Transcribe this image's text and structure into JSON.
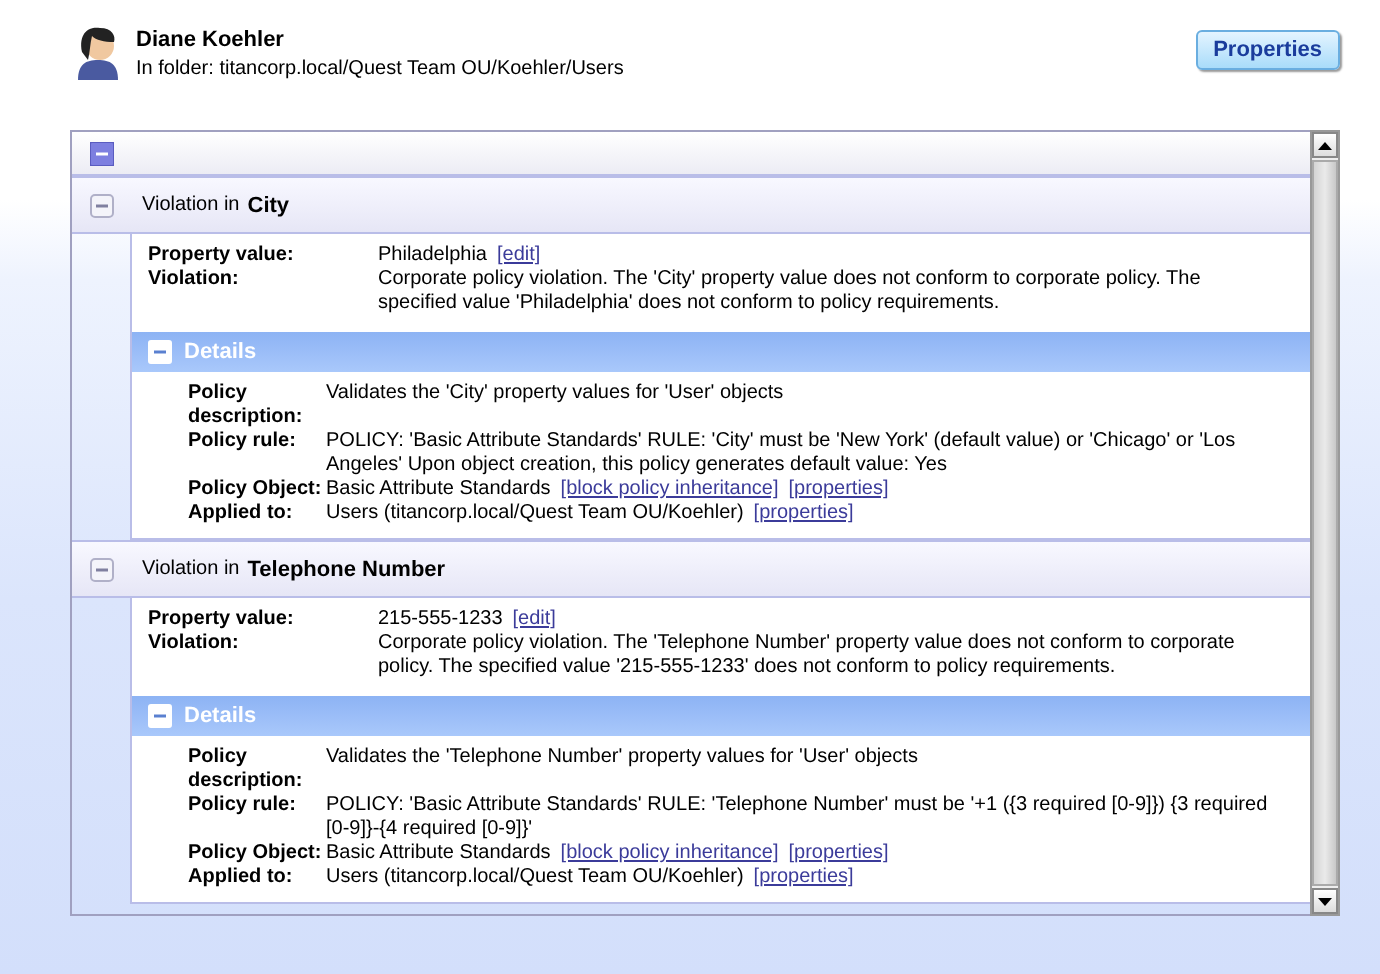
{
  "user": {
    "name": "Diane Koehler",
    "folder": "In folder: titancorp.local/Quest Team OU/Koehler/Users"
  },
  "properties_button": "Properties",
  "all_expanded": true,
  "violations": [
    {
      "label": "Violation in",
      "property": "City",
      "expanded": true,
      "fields": [
        {
          "label": "Property value:",
          "value": "Philadelphia",
          "links": [
            "[edit]"
          ]
        },
        {
          "label": "Violation:",
          "value": "Corporate policy violation. The 'City' property value does not conform to corporate policy. The specified value 'Philadelphia' does not conform to policy requirements."
        }
      ],
      "details": {
        "title": "Details",
        "expanded": true,
        "fields": [
          {
            "label": "Policy description:",
            "value": "Validates the 'City' property values for 'User' objects"
          },
          {
            "label": "Policy rule:",
            "value": "POLICY: 'Basic Attribute Standards' RULE: 'City' must be 'New York' (default value) or 'Chicago' or 'Los Angeles' Upon object creation, this policy generates default value: Yes"
          },
          {
            "label": "Policy Object:",
            "value": "Basic Attribute Standards",
            "links": [
              "[block policy inheritance]",
              "[properties]"
            ]
          },
          {
            "label": "Applied to:",
            "value": "Users  (titancorp.local/Quest Team OU/Koehler)",
            "links": [
              "[properties]"
            ]
          }
        ]
      }
    },
    {
      "label": "Violation in",
      "property": "Telephone Number",
      "expanded": true,
      "fields": [
        {
          "label": "Property value:",
          "value": "215-555-1233",
          "links": [
            "[edit]"
          ]
        },
        {
          "label": "Violation:",
          "value": "Corporate policy violation. The 'Telephone Number' property value does not conform to corporate policy. The specified value '215-555-1233' does not conform to policy requirements."
        }
      ],
      "details": {
        "title": "Details",
        "expanded": true,
        "fields": [
          {
            "label": "Policy description:",
            "value": "Validates the 'Telephone Number' property values for 'User' objects"
          },
          {
            "label": "Policy rule:",
            "value": "POLICY: 'Basic Attribute Standards' RULE: 'Telephone Number' must be '+1 ({3 required [0-9]}) {3 required [0-9]}-{4 required [0-9]}'"
          },
          {
            "label": "Policy Object:",
            "value": "Basic Attribute Standards",
            "links": [
              "[block policy inheritance]",
              "[properties]"
            ]
          },
          {
            "label": "Applied to:",
            "value": "Users  (titancorp.local/Quest Team OU/Koehler)",
            "links": [
              "[properties]"
            ]
          }
        ]
      }
    }
  ]
}
